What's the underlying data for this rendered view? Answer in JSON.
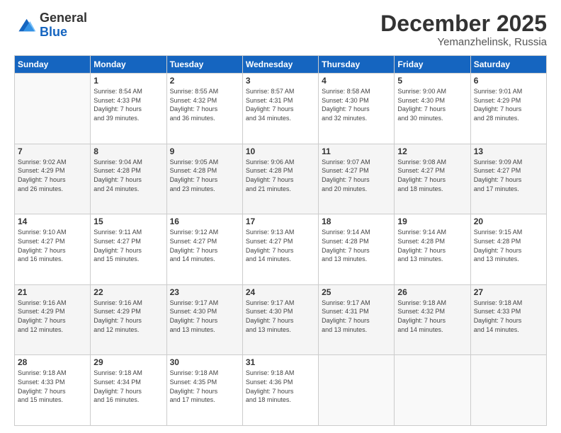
{
  "logo": {
    "line1": "General",
    "line2": "Blue"
  },
  "header": {
    "month": "December 2025",
    "location": "Yemanzhelinsk, Russia"
  },
  "weekdays": [
    "Sunday",
    "Monday",
    "Tuesday",
    "Wednesday",
    "Thursday",
    "Friday",
    "Saturday"
  ],
  "weeks": [
    [
      {
        "day": "",
        "info": ""
      },
      {
        "day": "1",
        "info": "Sunrise: 8:54 AM\nSunset: 4:33 PM\nDaylight: 7 hours\nand 39 minutes."
      },
      {
        "day": "2",
        "info": "Sunrise: 8:55 AM\nSunset: 4:32 PM\nDaylight: 7 hours\nand 36 minutes."
      },
      {
        "day": "3",
        "info": "Sunrise: 8:57 AM\nSunset: 4:31 PM\nDaylight: 7 hours\nand 34 minutes."
      },
      {
        "day": "4",
        "info": "Sunrise: 8:58 AM\nSunset: 4:30 PM\nDaylight: 7 hours\nand 32 minutes."
      },
      {
        "day": "5",
        "info": "Sunrise: 9:00 AM\nSunset: 4:30 PM\nDaylight: 7 hours\nand 30 minutes."
      },
      {
        "day": "6",
        "info": "Sunrise: 9:01 AM\nSunset: 4:29 PM\nDaylight: 7 hours\nand 28 minutes."
      }
    ],
    [
      {
        "day": "7",
        "info": "Sunrise: 9:02 AM\nSunset: 4:29 PM\nDaylight: 7 hours\nand 26 minutes."
      },
      {
        "day": "8",
        "info": "Sunrise: 9:04 AM\nSunset: 4:28 PM\nDaylight: 7 hours\nand 24 minutes."
      },
      {
        "day": "9",
        "info": "Sunrise: 9:05 AM\nSunset: 4:28 PM\nDaylight: 7 hours\nand 23 minutes."
      },
      {
        "day": "10",
        "info": "Sunrise: 9:06 AM\nSunset: 4:28 PM\nDaylight: 7 hours\nand 21 minutes."
      },
      {
        "day": "11",
        "info": "Sunrise: 9:07 AM\nSunset: 4:27 PM\nDaylight: 7 hours\nand 20 minutes."
      },
      {
        "day": "12",
        "info": "Sunrise: 9:08 AM\nSunset: 4:27 PM\nDaylight: 7 hours\nand 18 minutes."
      },
      {
        "day": "13",
        "info": "Sunrise: 9:09 AM\nSunset: 4:27 PM\nDaylight: 7 hours\nand 17 minutes."
      }
    ],
    [
      {
        "day": "14",
        "info": "Sunrise: 9:10 AM\nSunset: 4:27 PM\nDaylight: 7 hours\nand 16 minutes."
      },
      {
        "day": "15",
        "info": "Sunrise: 9:11 AM\nSunset: 4:27 PM\nDaylight: 7 hours\nand 15 minutes."
      },
      {
        "day": "16",
        "info": "Sunrise: 9:12 AM\nSunset: 4:27 PM\nDaylight: 7 hours\nand 14 minutes."
      },
      {
        "day": "17",
        "info": "Sunrise: 9:13 AM\nSunset: 4:27 PM\nDaylight: 7 hours\nand 14 minutes."
      },
      {
        "day": "18",
        "info": "Sunrise: 9:14 AM\nSunset: 4:28 PM\nDaylight: 7 hours\nand 13 minutes."
      },
      {
        "day": "19",
        "info": "Sunrise: 9:14 AM\nSunset: 4:28 PM\nDaylight: 7 hours\nand 13 minutes."
      },
      {
        "day": "20",
        "info": "Sunrise: 9:15 AM\nSunset: 4:28 PM\nDaylight: 7 hours\nand 13 minutes."
      }
    ],
    [
      {
        "day": "21",
        "info": "Sunrise: 9:16 AM\nSunset: 4:29 PM\nDaylight: 7 hours\nand 12 minutes."
      },
      {
        "day": "22",
        "info": "Sunrise: 9:16 AM\nSunset: 4:29 PM\nDaylight: 7 hours\nand 12 minutes."
      },
      {
        "day": "23",
        "info": "Sunrise: 9:17 AM\nSunset: 4:30 PM\nDaylight: 7 hours\nand 13 minutes."
      },
      {
        "day": "24",
        "info": "Sunrise: 9:17 AM\nSunset: 4:30 PM\nDaylight: 7 hours\nand 13 minutes."
      },
      {
        "day": "25",
        "info": "Sunrise: 9:17 AM\nSunset: 4:31 PM\nDaylight: 7 hours\nand 13 minutes."
      },
      {
        "day": "26",
        "info": "Sunrise: 9:18 AM\nSunset: 4:32 PM\nDaylight: 7 hours\nand 14 minutes."
      },
      {
        "day": "27",
        "info": "Sunrise: 9:18 AM\nSunset: 4:33 PM\nDaylight: 7 hours\nand 14 minutes."
      }
    ],
    [
      {
        "day": "28",
        "info": "Sunrise: 9:18 AM\nSunset: 4:33 PM\nDaylight: 7 hours\nand 15 minutes."
      },
      {
        "day": "29",
        "info": "Sunrise: 9:18 AM\nSunset: 4:34 PM\nDaylight: 7 hours\nand 16 minutes."
      },
      {
        "day": "30",
        "info": "Sunrise: 9:18 AM\nSunset: 4:35 PM\nDaylight: 7 hours\nand 17 minutes."
      },
      {
        "day": "31",
        "info": "Sunrise: 9:18 AM\nSunset: 4:36 PM\nDaylight: 7 hours\nand 18 minutes."
      },
      {
        "day": "",
        "info": ""
      },
      {
        "day": "",
        "info": ""
      },
      {
        "day": "",
        "info": ""
      }
    ]
  ]
}
